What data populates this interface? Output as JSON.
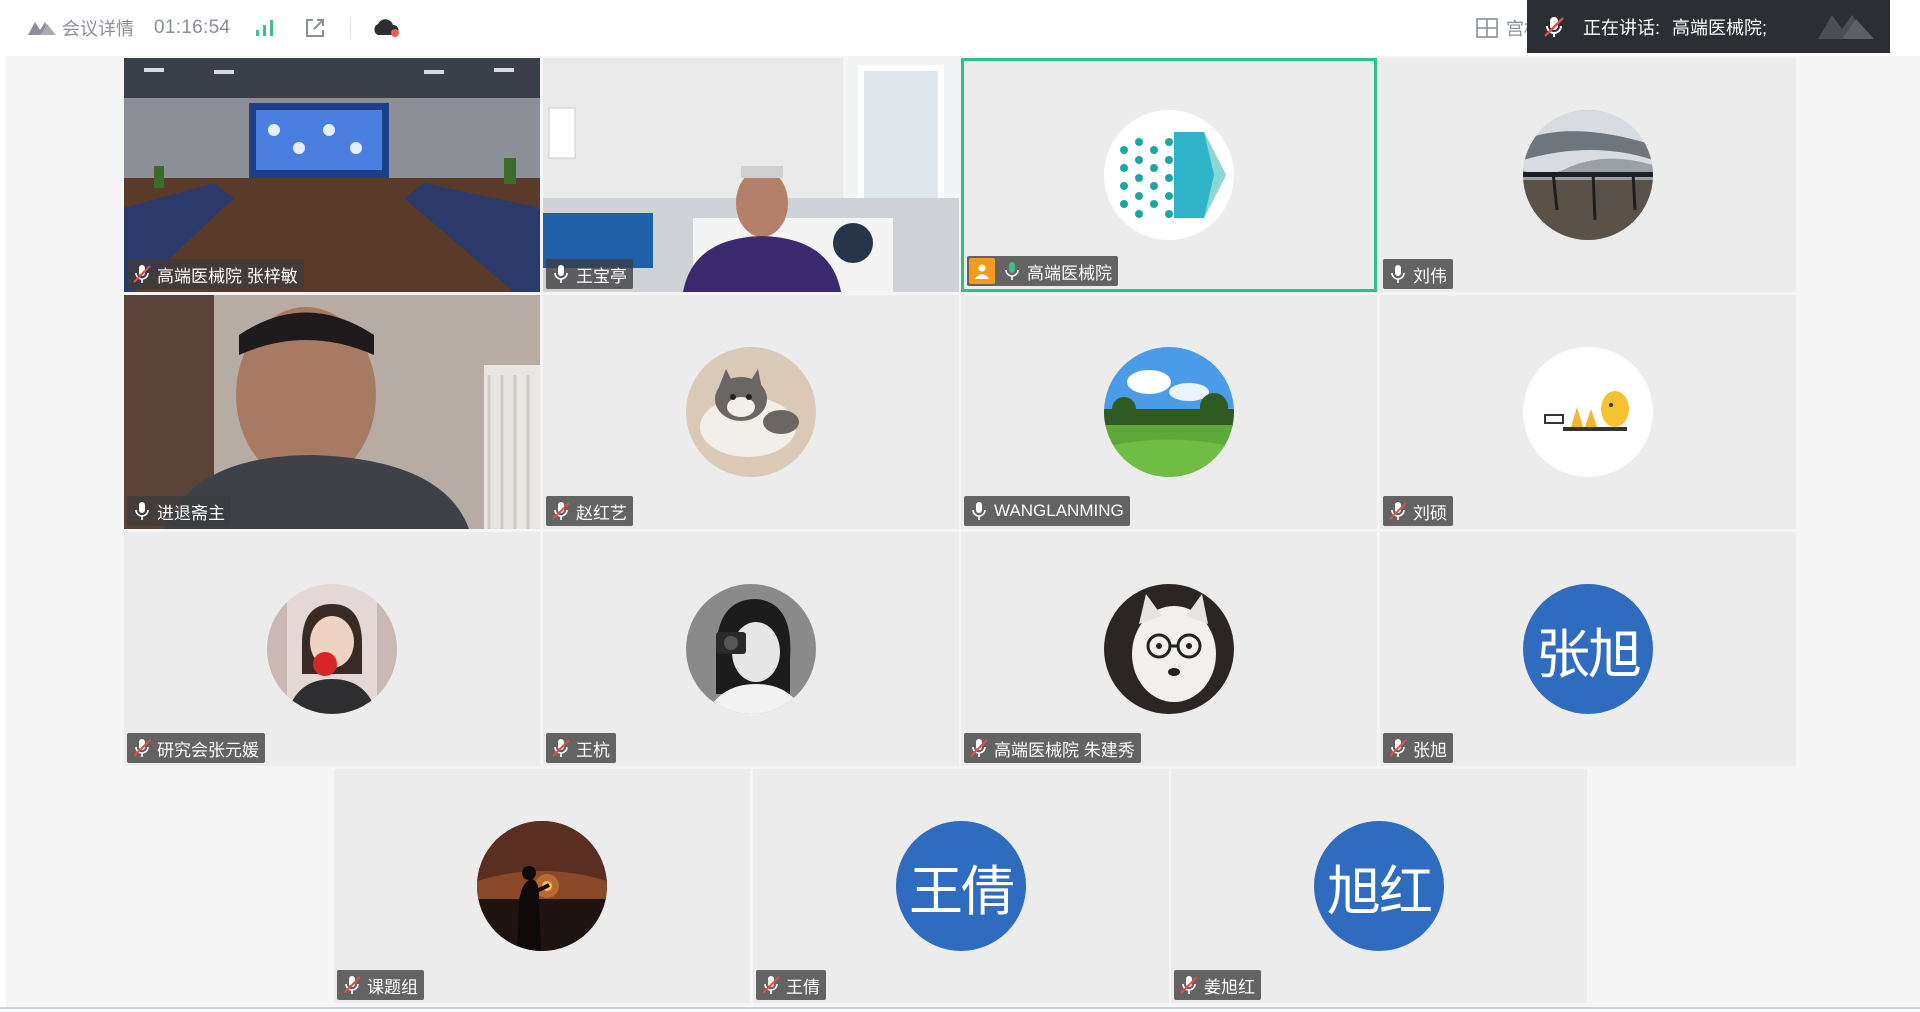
{
  "topbar": {
    "meeting_details": "会议详情",
    "duration": "01:16:54",
    "layout_label_partial": "宫格"
  },
  "speaking": {
    "label": "正在讲话:",
    "name": "高端医械院;"
  },
  "participants": [
    {
      "name": "高端医械院 张梓敏",
      "muted": true,
      "avatar": "video",
      "scene": "conference-room"
    },
    {
      "name": "王宝亭",
      "muted": false,
      "avatar": "video",
      "scene": "office-man"
    },
    {
      "name": "高端医械院",
      "muted": false,
      "avatar": "logo",
      "active": true,
      "host": true
    },
    {
      "name": "刘伟",
      "muted": false,
      "avatar": "photo-pier"
    },
    {
      "name": "进退斋主",
      "muted": false,
      "avatar": "video",
      "scene": "man-closeup"
    },
    {
      "name": "赵红艺",
      "muted": true,
      "avatar": "photo-cat"
    },
    {
      "name": "WANGLANMING",
      "muted": false,
      "avatar": "photo-golf"
    },
    {
      "name": "刘硕",
      "muted": true,
      "avatar": "photo-cartoon"
    },
    {
      "name": "研究会张元媛",
      "muted": true,
      "avatar": "photo-woman-apple"
    },
    {
      "name": "王杭",
      "muted": true,
      "avatar": "photo-woman-camera"
    },
    {
      "name": "高端医械院 朱建秀",
      "muted": true,
      "avatar": "photo-dog"
    },
    {
      "name": "张旭",
      "muted": true,
      "avatar": "text",
      "avatar_text": "张旭"
    },
    {
      "name": "课题组",
      "muted": true,
      "avatar": "photo-sunset"
    },
    {
      "name": "王倩",
      "muted": true,
      "avatar": "text",
      "avatar_text": "王倩"
    },
    {
      "name": "姜旭红",
      "muted": true,
      "avatar": "text",
      "avatar_text": "旭红"
    }
  ],
  "colors": {
    "active_border": "#2fbf8a",
    "avatar_blue": "#2f6cbf",
    "host_badge": "#f39b1f",
    "signal_green": "#3fbf8a",
    "speaking_bg": "#2b2e33"
  },
  "icons": {
    "logo": "meeting-logo-icon",
    "signal": "signal-bars-icon",
    "share": "external-link-icon",
    "cloud": "cloud-record-icon",
    "grid": "grid-layout-icon",
    "mic_muted": "mic-muted-icon",
    "mic": "mic-icon"
  }
}
